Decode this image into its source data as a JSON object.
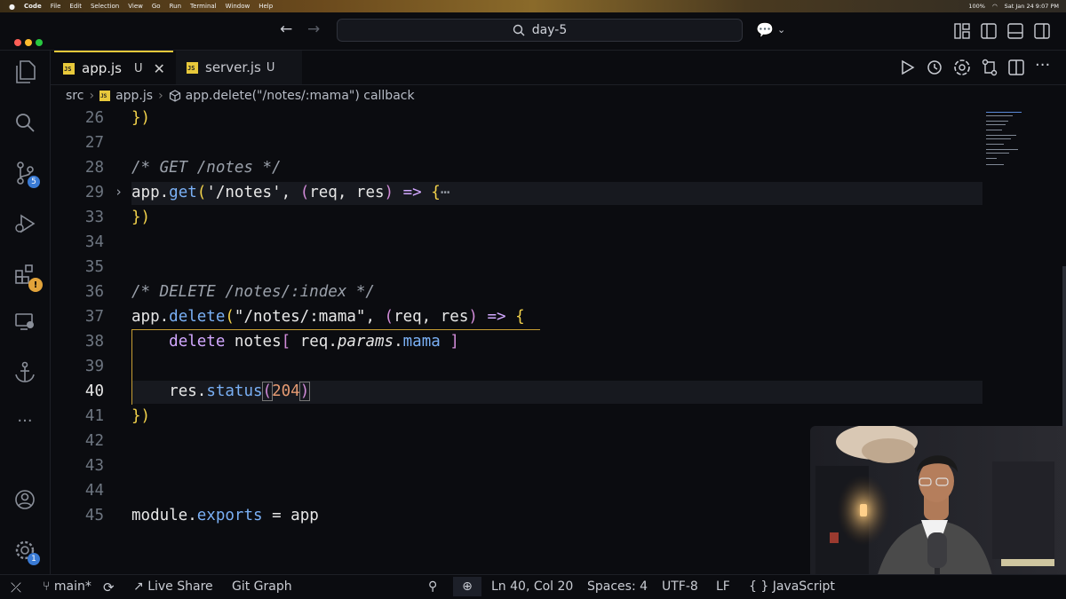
{
  "menubar": {
    "apple": "",
    "items": [
      "Code",
      "File",
      "Edit",
      "Selection",
      "View",
      "Go",
      "Run",
      "Terminal",
      "Window",
      "Help"
    ],
    "clock": "Sat Jan 24  9:07 PM",
    "battery": "100%"
  },
  "titlebar": {
    "search_text": "day-5"
  },
  "tabs": [
    {
      "icon_text": "JS",
      "label": "app.js",
      "status": "U",
      "active": true
    },
    {
      "icon_text": "JS",
      "label": "server.js",
      "status": "U",
      "active": false
    }
  ],
  "breadcrumb": {
    "segments": [
      "src",
      "app.js",
      "app.delete(\"/notes/:mama\") callback"
    ]
  },
  "activity": {
    "scm_badge": "5",
    "settings_badge": "1"
  },
  "editor": {
    "lines": [
      {
        "n": "26"
      },
      {
        "n": "27"
      },
      {
        "n": "28",
        "comment": "/* GET /notes */"
      },
      {
        "n": "29"
      },
      {
        "n": "33"
      },
      {
        "n": "34"
      },
      {
        "n": "35"
      },
      {
        "n": "36",
        "comment": "/* DELETE /notes/:index */"
      },
      {
        "n": "37"
      },
      {
        "n": "38"
      },
      {
        "n": "39"
      },
      {
        "n": "40"
      },
      {
        "n": "41"
      },
      {
        "n": "42"
      },
      {
        "n": "43"
      },
      {
        "n": "44"
      },
      {
        "n": "45"
      }
    ],
    "tokens": {
      "close_brace": "})",
      "app": "app",
      "get": "get",
      "get_path": "'/notes'",
      "req": "req",
      "res": "res",
      "arrow": "=>",
      "ellipsis": "⋯",
      "delete_fn": "delete",
      "delete_path": "\"/notes/:mama\"",
      "delete_kw": "delete",
      "notes": "notes",
      "params": "params",
      "mama": "mama",
      "status": "status",
      "code_204": "204",
      "module": "module",
      "exports": "exports",
      "eq": "="
    }
  },
  "statusbar": {
    "branch": "main*",
    "live_share": "Live Share",
    "git_graph": "Git Graph",
    "position": "Ln 40, Col 20",
    "spaces": "Spaces: 4",
    "encoding": "UTF-8",
    "eol": "LF",
    "language": "JavaScript",
    "language_prefix": "{ }"
  },
  "colors": {
    "background": "#0b0c10",
    "js_badge": "#e8c93b",
    "keyword": "#d2a8ff",
    "function": "#7ab0f5",
    "bracket": "#f2d24b",
    "number": "#e59a72",
    "accent": "#3a7bd5"
  }
}
